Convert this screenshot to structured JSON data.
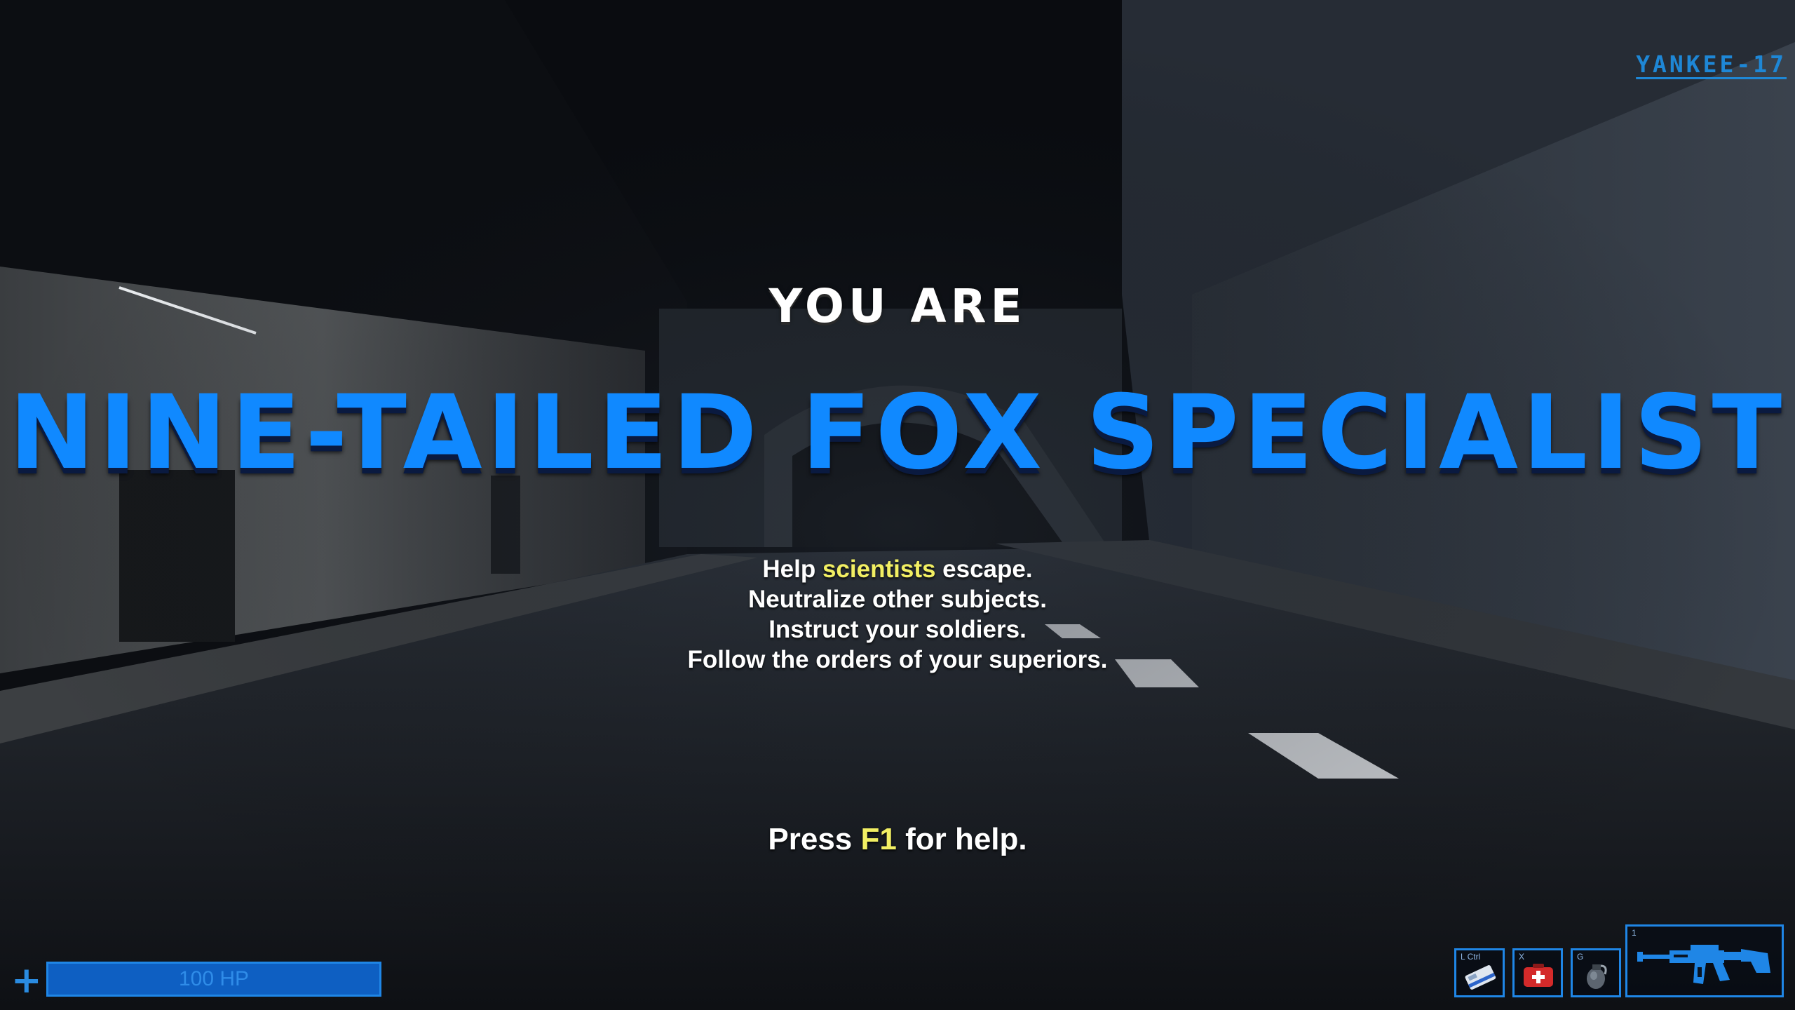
{
  "hud": {
    "callsign": "YANKEE-17",
    "you_are": "YOU ARE",
    "role": "NINE-TAILED FOX SPECIALIST",
    "role_color": "#1089ff",
    "objectives": [
      {
        "pre": "Help ",
        "highlight": "scientists",
        "post": " escape."
      },
      {
        "pre": "Neutralize other subjects.",
        "highlight": "",
        "post": ""
      },
      {
        "pre": "Instruct your soldiers.",
        "highlight": "",
        "post": ""
      },
      {
        "pre": "Follow the orders of your superiors.",
        "highlight": "",
        "post": ""
      }
    ],
    "help_hint": {
      "pre": "Press ",
      "key": "F1",
      "post": " for help."
    },
    "highlight_color": "#f2ef63"
  },
  "health": {
    "icon": "plus-icon",
    "label": "100 HP",
    "fraction": 1.0
  },
  "inventory": [
    {
      "key": "L Ctrl",
      "icon": "keycard-icon"
    },
    {
      "key": "X",
      "icon": "medkit-icon"
    },
    {
      "key": "G",
      "icon": "grenade-icon"
    },
    {
      "key": "1",
      "icon": "rifle-icon"
    }
  ]
}
